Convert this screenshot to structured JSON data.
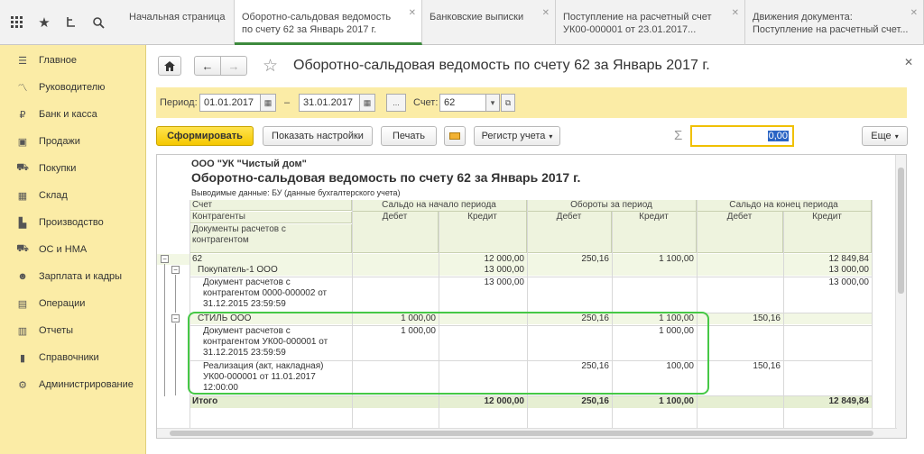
{
  "tabs": [
    {
      "label": "Начальная страница",
      "active": false
    },
    {
      "label": "Оборотно-сальдовая ведомость по счету 62 за Январь 2017 г.",
      "active": true
    },
    {
      "label": "Банковские выписки",
      "active": false
    },
    {
      "label": "Поступление на расчетный счет УК00-000001 от 23.01.2017...",
      "active": false
    },
    {
      "label": "Движения документа: Поступление на расчетный счет...",
      "active": false
    }
  ],
  "tab_lines": [
    [
      "Начальная страница"
    ],
    [
      "Оборотно-сальдовая ведомость",
      "по счету 62 за Январь 2017 г."
    ],
    [
      "Банковские выписки"
    ],
    [
      "Поступление на расчетный счет",
      "УК00-000001 от 23.01.2017..."
    ],
    [
      "Движения документа:",
      "Поступление на расчетный счет..."
    ]
  ],
  "sidebar": {
    "items": [
      {
        "label": "Главное",
        "icon": "menu-icon"
      },
      {
        "label": "Руководителю",
        "icon": "trend-icon"
      },
      {
        "label": "Банк и касса",
        "icon": "ruble-icon"
      },
      {
        "label": "Продажи",
        "icon": "bag-icon"
      },
      {
        "label": "Покупки",
        "icon": "cart-icon"
      },
      {
        "label": "Склад",
        "icon": "warehouse-icon"
      },
      {
        "label": "Производство",
        "icon": "factory-icon"
      },
      {
        "label": "ОС и НМА",
        "icon": "truck-icon"
      },
      {
        "label": "Зарплата и кадры",
        "icon": "people-icon"
      },
      {
        "label": "Операции",
        "icon": "calculator-icon"
      },
      {
        "label": "Отчеты",
        "icon": "chart-icon"
      },
      {
        "label": "Справочники",
        "icon": "book-icon"
      },
      {
        "label": "Администрирование",
        "icon": "gear-icon"
      }
    ]
  },
  "header": {
    "title": "Оборотно-сальдовая ведомость по счету 62 за Январь 2017 г."
  },
  "filter": {
    "period_label": "Период:",
    "date_from": "01.01.2017",
    "dash": "–",
    "date_to": "31.01.2017",
    "dots": "...",
    "account_label": "Счет:",
    "account": "62"
  },
  "toolbar": {
    "generate": "Сформировать",
    "show_settings": "Показать настройки",
    "print": "Печать",
    "register": "Регистр учета",
    "sigma": "Σ",
    "sum_value": "0,00",
    "more": "Еще"
  },
  "report": {
    "org": "ООО \"УК \"Чистый дом\"",
    "title": "Оборотно-сальдовая ведомость по счету 62 за Январь 2017 г.",
    "note": "Выводимые данные:  БУ (данные бухгалтерского учета)",
    "headers": {
      "account": "Счет",
      "counterparty": "Контрагенты",
      "documents": [
        "Документы расчетов с",
        "контрагентом"
      ],
      "opening": "Сальдо на начало периода",
      "turnover": "Обороты за период",
      "closing": "Сальдо на конец периода",
      "debit": "Дебет",
      "credit": "Кредит"
    },
    "rows": [
      {
        "level": 0,
        "lines": [
          "62"
        ],
        "ob_d": "",
        "ob_c": "12 000,00",
        "t_d": "250,16",
        "t_c": "1 100,00",
        "cb_d": "",
        "cb_c": "12 849,84"
      },
      {
        "level": 1,
        "lines": [
          "Покупатель-1 ООО"
        ],
        "ob_d": "",
        "ob_c": "13 000,00",
        "t_d": "",
        "t_c": "",
        "cb_d": "",
        "cb_c": "13 000,00"
      },
      {
        "level": 2,
        "lines": [
          "Документ расчетов с",
          "контрагентом 0000-000002 от",
          "31.12.2015 23:59:59"
        ],
        "ob_d": "",
        "ob_c": "13 000,00",
        "t_d": "",
        "t_c": "",
        "cb_d": "",
        "cb_c": "13 000,00"
      },
      {
        "level": 1,
        "lines": [
          "СТИЛЬ ООО"
        ],
        "ob_d": "1 000,00",
        "ob_c": "",
        "t_d": "250,16",
        "t_c": "1 100,00",
        "cb_d": "150,16",
        "cb_c": ""
      },
      {
        "level": 2,
        "lines": [
          "Документ расчетов с",
          "контрагентом УК00-000001 от",
          "31.12.2015 23:59:59"
        ],
        "ob_d": "1 000,00",
        "ob_c": "",
        "t_d": "",
        "t_c": "1 000,00",
        "cb_d": "",
        "cb_c": ""
      },
      {
        "level": 2,
        "lines": [
          "Реализация (акт, накладная)",
          "УК00-000001 от 11.01.2017",
          "12:00:00"
        ],
        "ob_d": "",
        "ob_c": "",
        "t_d": "250,16",
        "t_c": "100,00",
        "cb_d": "150,16",
        "cb_c": ""
      }
    ],
    "total": {
      "label": "Итого",
      "ob_d": "",
      "ob_c": "12 000,00",
      "t_d": "250,16",
      "t_c": "1 100,00",
      "cb_d": "",
      "cb_c": "12 849,84"
    }
  },
  "colors": {
    "sidebar": "#fbeca6",
    "accent_green": "#46c846",
    "button_yellow": "#f5c800"
  }
}
